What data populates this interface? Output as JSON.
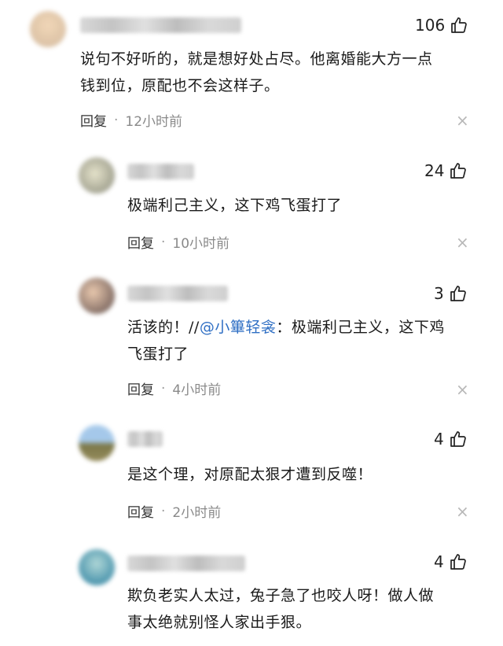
{
  "comments": [
    {
      "likes": "106",
      "text_lines": [
        "说句不好听的，就是想好处占尽。他离婚能大方一点",
        "钱到位，原配也不会这样子。"
      ],
      "reply_label": "回复",
      "time": "12小时前",
      "avatar_colors": [
        "#e8c9a6",
        "#d3b597"
      ]
    },
    {
      "likes": "24",
      "text_lines": [
        "极端利己主义，这下鸡飞蛋打了"
      ],
      "reply_label": "回复",
      "time": "10小时前",
      "avatar_colors": [
        "#b9b9a6",
        "#8f8f84"
      ]
    },
    {
      "likes": "3",
      "text_prefix": "活该的！//",
      "mention": "@小篳轻衾",
      "text_suffix": "：极端利己主义，这下鸡",
      "text_line2": "飞蛋打了",
      "reply_label": "回复",
      "time": "4小时前",
      "avatar_colors": [
        "#c9a58e",
        "#6d5b54"
      ]
    },
    {
      "likes": "4",
      "text_lines": [
        "是这个理，对原配太狠才遭到反噬！"
      ],
      "reply_label": "回复",
      "time": "2小时前",
      "avatar_colors": [
        "#8db3d9",
        "#7d6e3c"
      ]
    },
    {
      "likes": "4",
      "text_lines": [
        "欺负老实人太过，兔子急了也咬人呀！做人做",
        "事太绝就别怪人家出手狠。"
      ],
      "avatar_colors": [
        "#3f8fa8",
        "#9ec9c9"
      ]
    }
  ],
  "icons": {
    "like": "thumb-up-icon",
    "close": "close-icon"
  },
  "colors": {
    "mention": "#2f6fc4",
    "meta": "#8a8a8a"
  }
}
